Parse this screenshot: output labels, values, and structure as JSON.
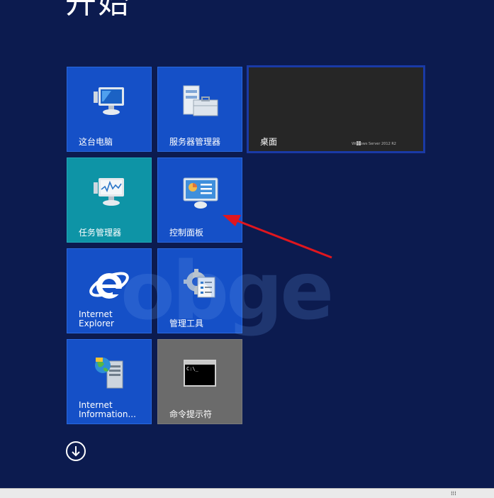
{
  "start": {
    "title": "开始"
  },
  "tiles": [
    {
      "label": "这台电脑",
      "icon": "computer-icon"
    },
    {
      "label": "服务器管理器",
      "icon": "server-manager-icon"
    },
    {
      "label": "桌面",
      "icon": "desktop-icon",
      "brand": "Windows Server 2012 R2"
    },
    {
      "label": "任务管理器",
      "icon": "task-manager-icon"
    },
    {
      "label": "控制面板",
      "icon": "control-panel-icon"
    },
    {
      "label": "Internet\nExplorer",
      "icon": "internet-explorer-icon"
    },
    {
      "label": "管理工具",
      "icon": "admin-tools-icon"
    },
    {
      "label": "Internet\nInformation...",
      "icon": "iis-icon"
    },
    {
      "label": "命令提示符",
      "icon": "command-prompt-icon"
    }
  ],
  "watermark": "obge",
  "colors": {
    "background": "#0c1b4f",
    "tile_blue": "#1550c7",
    "tile_teal": "#0e94a6",
    "tile_gray": "#6b6b6b",
    "arrow": "#e0161e"
  }
}
